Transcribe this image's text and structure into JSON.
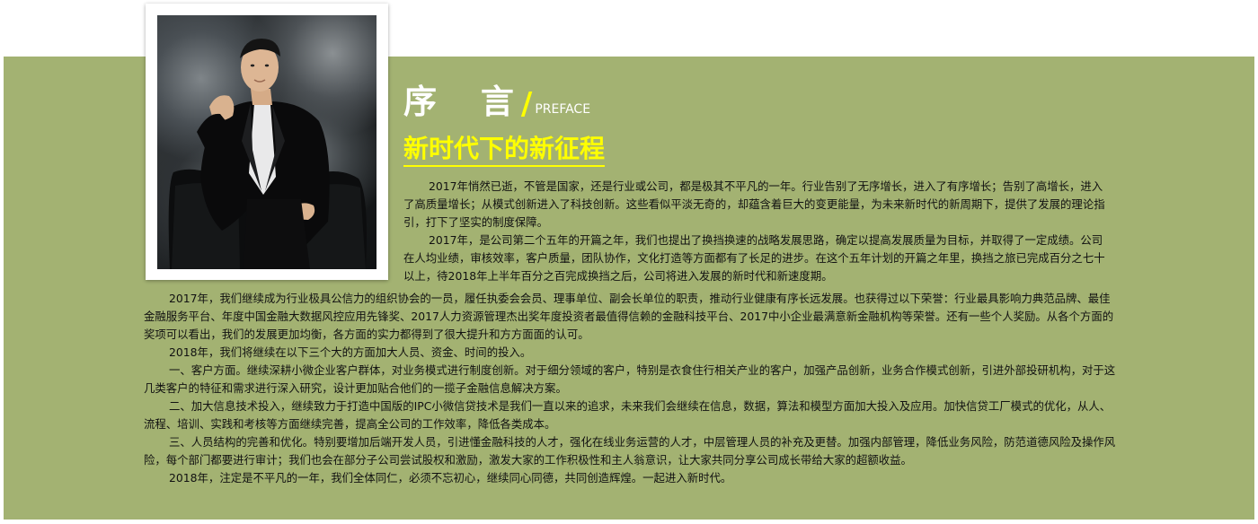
{
  "heading": {
    "title_cn": "序 言",
    "slash": "/",
    "title_en": "PREFACE"
  },
  "subheading": "新时代下的新征程",
  "photo": {
    "icon": "portrait-photo",
    "description_visible": false
  },
  "colors": {
    "band": "#a3b272",
    "accent": "#ffff00",
    "heading": "#ffffff",
    "body_text": "#111111"
  },
  "paragraphs_upper": [
    "2017年悄然已逝，不管是国家，还是行业或公司，都是极其不平凡的一年。行业告别了无序增长，进入了有序增长；告别了高增长，进入了高质量增长；从模式创新进入了科技创新。这些看似平淡无奇的，却蕴含着巨大的变更能量，为未来新时代的新周期下，提供了发展的理论指引，打下了坚实的制度保障。",
    "2017年，是公司第二个五年的开篇之年，我们也提出了换挡换速的战略发展思路，确定以提高发展质量为目标，并取得了一定成绩。公司在人均业绩，审核效率，客户质量，团队协作，文化打造等方面都有了长足的进步。在这个五年计划的开篇之年里，换挡之旅已完成百分之七十以上，待2018年上半年百分之百完成换挡之后，公司将进入发展的新时代和新速度期。"
  ],
  "paragraphs_lower": [
    "2017年，我们继续成为行业极具公信力的组织协会的一员，履任执委会会员、理事单位、副会长单位的职责，推动行业健康有序长远发展。也获得过以下荣誉：行业最具影响力典范品牌、最佳金融服务平台、年度中国金融大数据风控应用先锋奖、2017人力资源管理杰出奖年度投资者最值得信赖的金融科技平台、2017中小企业最满意新金融机构等荣誉。还有一些个人奖励。从各个方面的奖项可以看出，我们的发展更加均衡，各方面的实力都得到了很大提升和方方面面的认可。",
    "2018年，我们将继续在以下三个大的方面加大人员、资金、时间的投入。",
    "一、客户方面。继续深耕小微企业客户群体，对业务模式进行制度创新。对于细分领域的客户，特别是衣食住行相关产业的客户，加强产品创新，业务合作模式创新，引进外部投研机构，对于这几类客户的特征和需求进行深入研究，设计更加贴合他们的一揽子金融信息解决方案。",
    "二、加大信息技术投入，继续致力于打造中国版的IPC小微信贷技术是我们一直以来的追求，未来我们会继续在信息，数据，算法和模型方面加大投入及应用。加快信贷工厂模式的优化，从人、流程、培训、实践和考核等方面继续完善，提高全公司的工作效率，降低各类成本。",
    "三、人员结构的完善和优化。特别要增加后端开发人员，引进懂金融科技的人才，强化在线业务运营的人才，中层管理人员的补充及更替。加强内部管理，降低业务风险，防范道德风险及操作风险，每个部门都要进行审计；我们也会在部分子公司尝试股权和激励，激发大家的工作积极性和主人翁意识，让大家共同分享公司成长带给大家的超额收益。",
    "2018年，注定是不平凡的一年，我们全体同仁，必须不忘初心，继续同心同德，共同创造辉煌。一起进入新时代。"
  ]
}
